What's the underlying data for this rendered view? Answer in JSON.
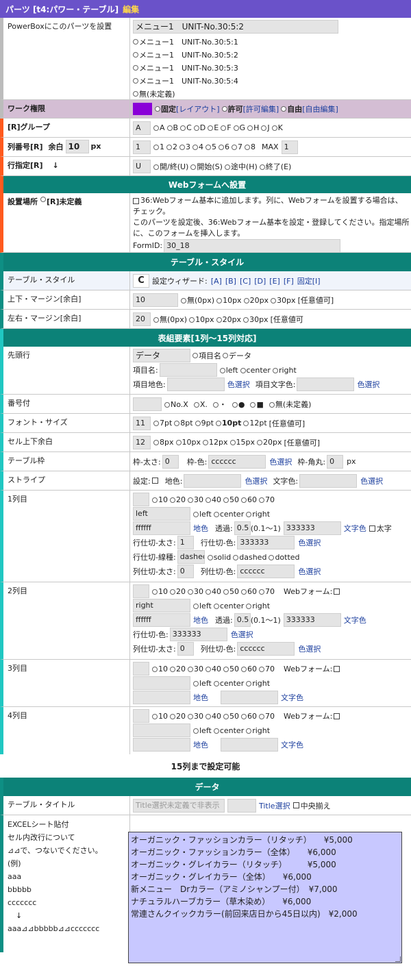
{
  "header": {
    "title": "パーツ [t4:パワー・テーブル]",
    "edit": "編集"
  },
  "powerbox": {
    "label": "PowerBoxにこのパーツを設置",
    "value": "メニュー1　UNIT-No.30:5:2",
    "options": [
      "メニュー1　UNIT-No.30:5:1",
      "メニュー1　UNIT-No.30:5:2",
      "メニュー1　UNIT-No.30:5:3",
      "メニュー1　UNIT-No.30:5:4",
      "無(未定義)"
    ]
  },
  "work": {
    "label": "ワーク権限",
    "color": "#8a00d8",
    "opt1": "固定",
    "opt1b": "[レイアウト]",
    "opt2": "許可",
    "opt2b": "[許可編集]",
    "opt3": "自由",
    "opt3b": "[自由編集]"
  },
  "group": {
    "label": "[R]グループ",
    "value": "A",
    "options": [
      "A",
      "B",
      "C",
      "D",
      "E",
      "F",
      "G",
      "H",
      "J",
      "K"
    ]
  },
  "colnum": {
    "label": "列番号[R]",
    "margin_label": "余白",
    "margin_value": "10",
    "unit": "px",
    "value": "1",
    "options": [
      "1",
      "2",
      "3",
      "4",
      "5",
      "6",
      "7",
      "8"
    ],
    "max_label": "MAX",
    "max_value": "1"
  },
  "rowspec": {
    "label": "行指定[R]",
    "arrow": "↓",
    "value": "U",
    "options": [
      "開/終(U)",
      "開始(S)",
      "途中(H)",
      "終了(E)"
    ]
  },
  "webform": {
    "section": "Webフォームへ設置",
    "place_label": "設置場所",
    "undefined": "[R]未定義",
    "text1": "36:Webフォーム基本に追加します。列に、Webフォームを設置する場合は、",
    "text2": "チェック。",
    "text3": "このパーツを設定後、36:Webフォーム基本を設定・登録してください。指定場所",
    "text4": "に、このフォームを挿入します。",
    "formid_label": "FormID:",
    "formid_value": "30_18"
  },
  "tstyle": {
    "section": "テーブル・スタイル",
    "label": "テーブル・スタイル",
    "value": "C",
    "wizard": "設定ウィザード:",
    "links": [
      "[A]",
      "[B]",
      "[C]",
      "[D]",
      "[E]",
      "[F]",
      "固定[I]"
    ]
  },
  "vmargin": {
    "label": "上下・マージン[余白]",
    "value": "10",
    "options": [
      "無(0px)",
      "10px",
      "20px",
      "30px"
    ],
    "any": "[任意値可]"
  },
  "hmargin": {
    "label": "左右・マージン[余白]",
    "value": "20",
    "options": [
      "無(0px)",
      "10px",
      "20px",
      "30px"
    ],
    "any": "[任意値可"
  },
  "elements": {
    "section": "表組要素[1列～15列対応]"
  },
  "headrow": {
    "label": "先頭行",
    "value": "データ",
    "opt1": "項目名",
    "opt2": "データ",
    "name_label": "項目名:",
    "align": [
      "left",
      "center",
      "right"
    ],
    "bg_label": "項目地色:",
    "bg_select": "色選択",
    "text_label": "項目文字色:",
    "text_select": "色選択"
  },
  "numbering": {
    "label": "番号付",
    "options": [
      "No.X",
      "X.",
      "・",
      "●",
      "■",
      "無(未定義)"
    ]
  },
  "fontsize": {
    "label": "フォント・サイズ",
    "value": "11",
    "options": [
      "7pt",
      "8pt",
      "9pt",
      "10pt",
      "12pt"
    ],
    "any": "[任意値可]"
  },
  "padding": {
    "label": "セル上下余白",
    "value": "12",
    "options": [
      "8px",
      "10px",
      "12px",
      "15px",
      "20px"
    ],
    "any": "[任意値可]"
  },
  "border": {
    "label": "テーブル枠",
    "w_label": "枠-太さ:",
    "w_value": "0",
    "c_label": "枠-色:",
    "c_value": "cccccc",
    "select": "色選択",
    "r_label": "枠-角丸:",
    "r_value": "0",
    "unit": "px"
  },
  "stripe": {
    "label": "ストライプ",
    "set_label": "設定:",
    "bg_label": "地色:",
    "select1": "色選択",
    "tc_label": "文字色:",
    "select2": "色選択"
  },
  "widths": [
    "10",
    "20",
    "30",
    "40",
    "50",
    "60",
    "70"
  ],
  "aligns": [
    "left",
    "center",
    "right"
  ],
  "col1": {
    "label": "1列目",
    "align": "left",
    "bg": "ffffff",
    "bg_label": "地色",
    "op_label": "透過:",
    "op_value": "0.5",
    "op_range": "(0.1～1)",
    "tc": "333333",
    "tc_label": "文字色",
    "bold_label": "太字",
    "rw_label": "行仕切-太さ:",
    "rw_value": "1",
    "rc_label": "行仕切-色:",
    "rc_value": "333333",
    "select": "色選択",
    "rs_label": "行仕切-線種:",
    "rs_value": "dashed",
    "styles": [
      "solid",
      "dashed",
      "dotted"
    ],
    "cw_label": "列仕切-太さ:",
    "cw_value": "0",
    "cc_label": "列仕切-色:",
    "cc_value": "cccccc",
    "select2": "色選択"
  },
  "col2": {
    "label": "2列目",
    "webform": "Webフォーム:",
    "align": "right",
    "bg": "ffffff",
    "bg_label": "地色",
    "op_label": "透過:",
    "op_value": "0.5",
    "op_range": "(0.1～1)",
    "tc": "333333",
    "tc_label": "文字色",
    "rc_label": "行仕切-色:",
    "rc_value": "333333",
    "select": "色選択",
    "cw_label": "列仕切-太さ:",
    "cw_value": "0",
    "cc_label": "列仕切-色:",
    "cc_value": "cccccc",
    "select2": "色選択"
  },
  "col3": {
    "label": "3列目",
    "webform": "Webフォーム:",
    "bg_label": "地色",
    "tc_label": "文字色"
  },
  "col4": {
    "label": "4列目",
    "webform": "Webフォーム:",
    "bg_label": "地色",
    "tc_label": "文字色"
  },
  "upto": "15列まで設定可能",
  "data": {
    "section": "データ",
    "title_label": "テーブル・タイトル",
    "title_placeholder": "Title選択未定義で非表示",
    "title_select": "Title選択",
    "center_label": "中央揃え",
    "excel_label": "EXCELシート貼付",
    "note1": "セル内改行について",
    "note2": "⊿⊿で、つないでください。",
    "note3": "(例)",
    "note4": "aaa",
    "note5": "bbbbb",
    "note6": "ccccccc",
    "note7": "↓",
    "note8": "aaa⊿⊿bbbbb⊿⊿ccccccc",
    "lines": [
      "オーガニック・ファッションカラー（リタッチ）　　¥5,000",
      "オーガニック・ファッションカラー（全体）　　¥6,000",
      "オーガニック・グレイカラー（リタッチ）　　　¥5,000",
      "オーガニック・グレイカラー（全体）　　¥6,000",
      "新メニュー　Drカラー（アミノシャンプー付）　¥7,000",
      "ナチュラルハーブカラー（草木染め）　　¥6,000",
      "常連さんクイックカラー(前回来店日から45日以内)　¥2,000"
    ]
  }
}
